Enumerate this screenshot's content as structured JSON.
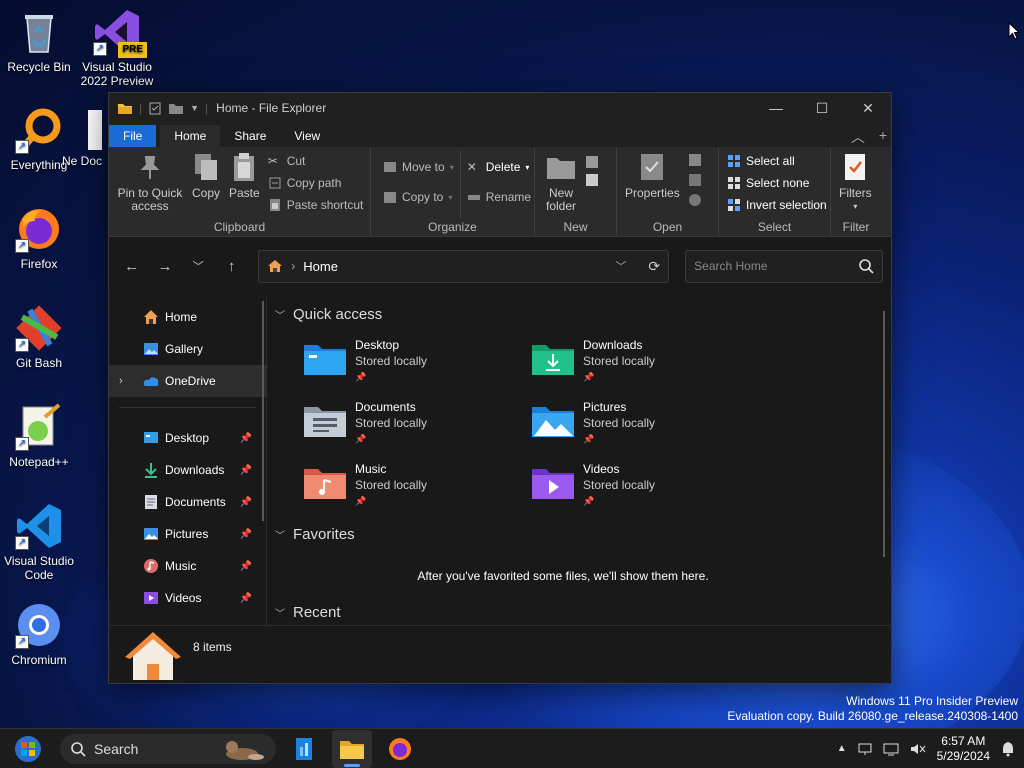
{
  "desktop": {
    "icons": [
      {
        "label": "Recycle Bin"
      },
      {
        "label": "Visual Studio 2022 Preview",
        "badge": "PRE"
      },
      {
        "label": "Everything"
      },
      {
        "label": "Ne Doc"
      },
      {
        "label": "Firefox"
      },
      {
        "label": "Git Bash"
      },
      {
        "label": "Notepad++"
      },
      {
        "label": "Visual Studio Code"
      },
      {
        "label": "Chromium"
      }
    ]
  },
  "explorer": {
    "title": "Home - File Explorer",
    "tabs": [
      "File",
      "Home",
      "Share",
      "View"
    ],
    "ribbon": {
      "clipboard": {
        "label": "Clipboard",
        "pin": "Pin to Quick access",
        "copy": "Copy",
        "paste": "Paste",
        "cut": "Cut",
        "copy_path": "Copy path",
        "paste_shortcut": "Paste shortcut"
      },
      "organize": {
        "label": "Organize",
        "move_to": "Move to",
        "copy_to": "Copy to",
        "delete": "Delete",
        "rename": "Rename"
      },
      "new": {
        "label": "New",
        "new_folder": "New folder"
      },
      "open": {
        "label": "Open",
        "properties": "Properties"
      },
      "select": {
        "label": "Select",
        "select_all": "Select all",
        "select_none": "Select none",
        "invert": "Invert selection"
      },
      "filter": {
        "label": "Filter",
        "filters": "Filters"
      }
    },
    "address": {
      "crumb": "Home"
    },
    "search": {
      "placeholder": "Search Home"
    },
    "nav": {
      "top": [
        "Home",
        "Gallery",
        "OneDrive"
      ],
      "pinned": [
        "Desktop",
        "Downloads",
        "Documents",
        "Pictures",
        "Music",
        "Videos"
      ]
    },
    "main": {
      "quick_access": "Quick access",
      "items": [
        {
          "name": "Desktop",
          "sub": "Stored locally"
        },
        {
          "name": "Downloads",
          "sub": "Stored locally"
        },
        {
          "name": "Documents",
          "sub": "Stored locally"
        },
        {
          "name": "Pictures",
          "sub": "Stored locally"
        },
        {
          "name": "Music",
          "sub": "Stored locally"
        },
        {
          "name": "Videos",
          "sub": "Stored locally"
        }
      ],
      "favorites": "Favorites",
      "favorites_empty": "After you've favorited some files, we'll show them here.",
      "recent": "Recent"
    },
    "status": {
      "count": "8 items"
    }
  },
  "watermark": {
    "line1": "Windows 11 Pro Insider Preview",
    "line2": "Evaluation copy. Build 26080.ge_release.240308-1400"
  },
  "taskbar": {
    "search_label": "Search",
    "time": "6:57 AM",
    "date": "5/29/2024"
  },
  "colors": {
    "accent": "#1a6bd6",
    "window_bg": "#191919",
    "ribbon_bg": "#2b2b2b",
    "taskbar_bg": "#1c1c1c"
  }
}
